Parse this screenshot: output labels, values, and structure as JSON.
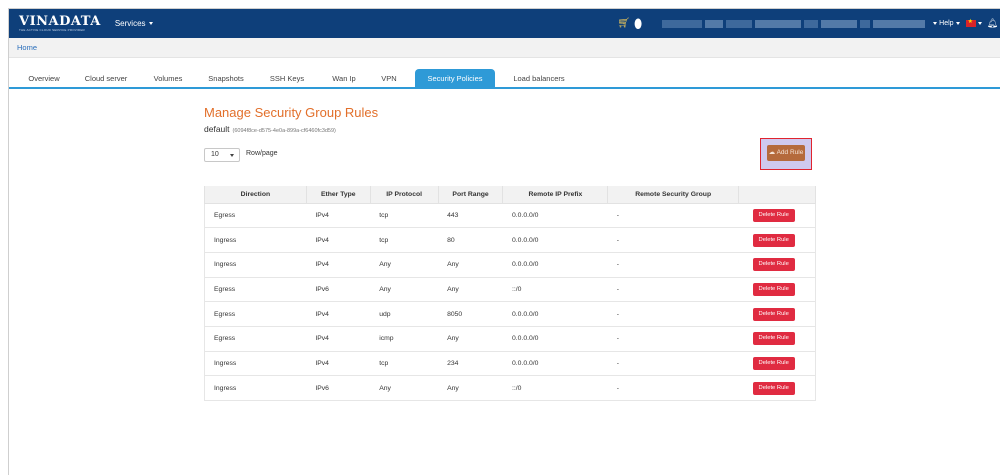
{
  "header": {
    "logo": "VINADATA",
    "logo_tagline": "THE ACTIVE CLOUD SERVICE PROVIDER",
    "services_label": "Services",
    "help_label": "Help"
  },
  "breadcrumb": {
    "home": "Home"
  },
  "tabs": [
    {
      "label": "Overview",
      "active": false
    },
    {
      "label": "Cloud server",
      "active": false
    },
    {
      "label": "Volumes",
      "active": false
    },
    {
      "label": "Snapshots",
      "active": false
    },
    {
      "label": "SSH Keys",
      "active": false
    },
    {
      "label": "Wan Ip",
      "active": false
    },
    {
      "label": "VPN",
      "active": false
    },
    {
      "label": "Security Policies",
      "active": true
    },
    {
      "label": "Load balancers",
      "active": false
    }
  ],
  "main": {
    "title": "Manage Security Group Rules",
    "group_name": "default",
    "group_id": "(6094f8ce-d575-4e0a-899a-cf6460fc3d59)",
    "rows_per_page": "10",
    "rows_per_page_label": "Row/page",
    "add_rule_label": "Add Rule"
  },
  "table": {
    "headers": [
      "Direction",
      "Ether Type",
      "IP Protocol",
      "Port Range",
      "Remote IP Prefix",
      "Remote Security Group",
      ""
    ],
    "action_label": "Delete Rule",
    "rows": [
      [
        "Egress",
        "IPv4",
        "tcp",
        "443",
        "0.0.0.0/0",
        "-"
      ],
      [
        "Ingress",
        "IPv4",
        "tcp",
        "80",
        "0.0.0.0/0",
        "-"
      ],
      [
        "Ingress",
        "IPv4",
        "Any",
        "Any",
        "0.0.0.0/0",
        "-"
      ],
      [
        "Egress",
        "IPv6",
        "Any",
        "Any",
        "::/0",
        "-"
      ],
      [
        "Egress",
        "IPv4",
        "udp",
        "8050",
        "0.0.0.0/0",
        "-"
      ],
      [
        "Egress",
        "IPv4",
        "icmp",
        "Any",
        "0.0.0.0/0",
        "-"
      ],
      [
        "Ingress",
        "IPv4",
        "tcp",
        "234",
        "0.0.0.0/0",
        "-"
      ],
      [
        "Ingress",
        "IPv6",
        "Any",
        "Any",
        "::/0",
        "-"
      ]
    ]
  },
  "colors": {
    "header_bg": "#0e3f7a",
    "tab_active": "#2e9ad7",
    "title": "#e26f2a",
    "delete_button": "#e02b41",
    "add_button": "#b56a3c",
    "highlight_border": "#e0242f"
  },
  "icons": [
    "cart-icon",
    "bottle-icon",
    "flag-icon",
    "bell-icon",
    "cloud-upload-icon"
  ]
}
